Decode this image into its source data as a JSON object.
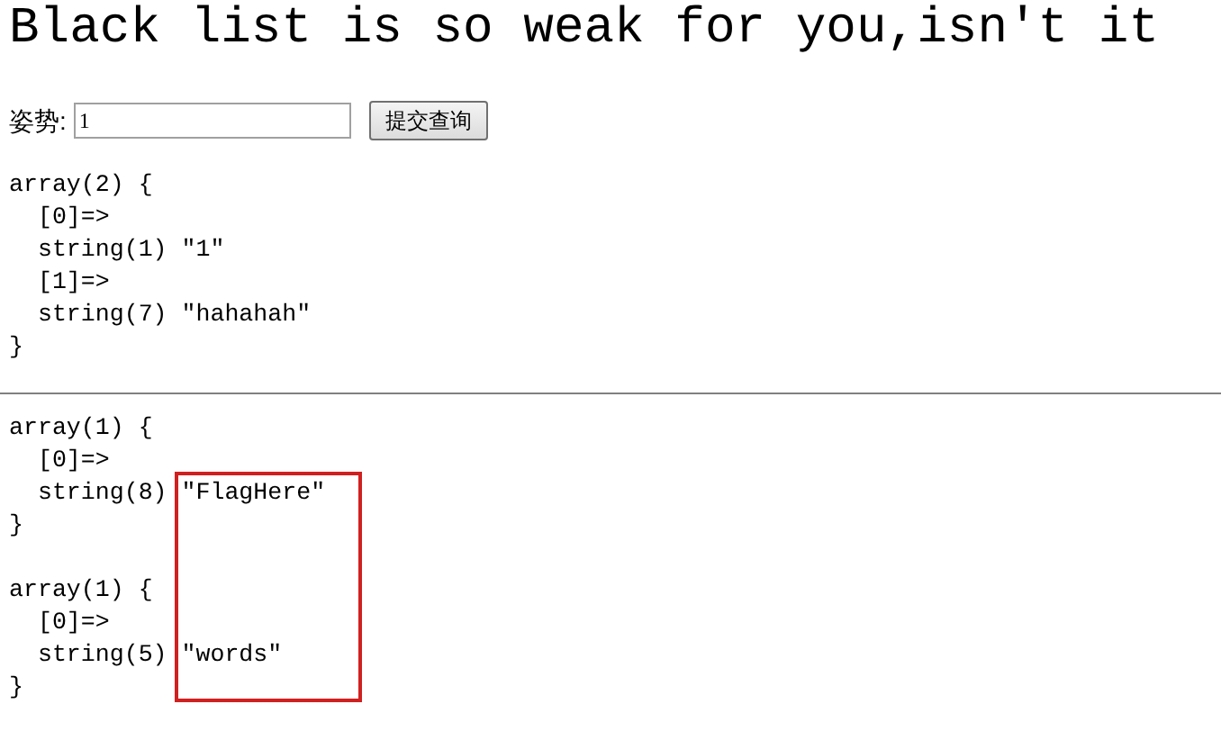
{
  "title": "Black list is so weak for you,isn't it",
  "form": {
    "label": "姿势:",
    "value": "1",
    "button": "提交查询"
  },
  "dumps": [
    {
      "lines": [
        "array(2) {",
        "  [0]=>",
        "  string(1) \"1\"",
        "  [1]=>",
        "  string(7) \"hahahah\"",
        "}"
      ]
    },
    {
      "lines": [
        "array(1) {",
        "  [0]=>",
        "  string(8) \"FlagHere\"",
        "}"
      ]
    },
    {
      "lines": [
        "array(1) {",
        "  [0]=>",
        "  string(5) \"words\"",
        "}"
      ]
    }
  ]
}
